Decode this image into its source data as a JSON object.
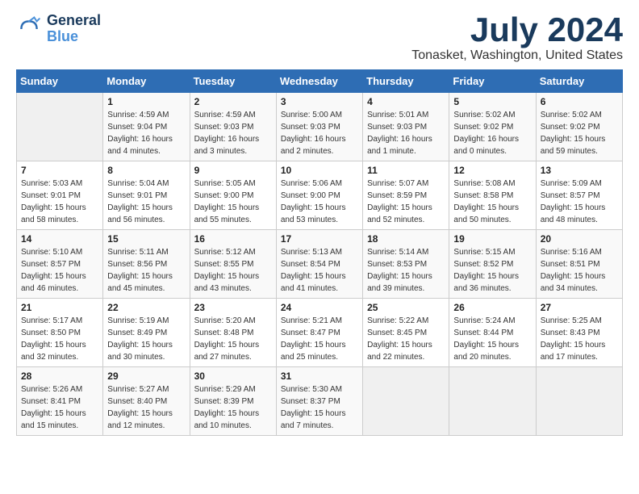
{
  "header": {
    "logo_line1": "General",
    "logo_line2": "Blue",
    "month": "July 2024",
    "location": "Tonasket, Washington, United States"
  },
  "weekdays": [
    "Sunday",
    "Monday",
    "Tuesday",
    "Wednesday",
    "Thursday",
    "Friday",
    "Saturday"
  ],
  "weeks": [
    [
      {
        "day": "",
        "info": ""
      },
      {
        "day": "1",
        "info": "Sunrise: 4:59 AM\nSunset: 9:04 PM\nDaylight: 16 hours\nand 4 minutes."
      },
      {
        "day": "2",
        "info": "Sunrise: 4:59 AM\nSunset: 9:03 PM\nDaylight: 16 hours\nand 3 minutes."
      },
      {
        "day": "3",
        "info": "Sunrise: 5:00 AM\nSunset: 9:03 PM\nDaylight: 16 hours\nand 2 minutes."
      },
      {
        "day": "4",
        "info": "Sunrise: 5:01 AM\nSunset: 9:03 PM\nDaylight: 16 hours\nand 1 minute."
      },
      {
        "day": "5",
        "info": "Sunrise: 5:02 AM\nSunset: 9:02 PM\nDaylight: 16 hours\nand 0 minutes."
      },
      {
        "day": "6",
        "info": "Sunrise: 5:02 AM\nSunset: 9:02 PM\nDaylight: 15 hours\nand 59 minutes."
      }
    ],
    [
      {
        "day": "7",
        "info": "Sunrise: 5:03 AM\nSunset: 9:01 PM\nDaylight: 15 hours\nand 58 minutes."
      },
      {
        "day": "8",
        "info": "Sunrise: 5:04 AM\nSunset: 9:01 PM\nDaylight: 15 hours\nand 56 minutes."
      },
      {
        "day": "9",
        "info": "Sunrise: 5:05 AM\nSunset: 9:00 PM\nDaylight: 15 hours\nand 55 minutes."
      },
      {
        "day": "10",
        "info": "Sunrise: 5:06 AM\nSunset: 9:00 PM\nDaylight: 15 hours\nand 53 minutes."
      },
      {
        "day": "11",
        "info": "Sunrise: 5:07 AM\nSunset: 8:59 PM\nDaylight: 15 hours\nand 52 minutes."
      },
      {
        "day": "12",
        "info": "Sunrise: 5:08 AM\nSunset: 8:58 PM\nDaylight: 15 hours\nand 50 minutes."
      },
      {
        "day": "13",
        "info": "Sunrise: 5:09 AM\nSunset: 8:57 PM\nDaylight: 15 hours\nand 48 minutes."
      }
    ],
    [
      {
        "day": "14",
        "info": "Sunrise: 5:10 AM\nSunset: 8:57 PM\nDaylight: 15 hours\nand 46 minutes."
      },
      {
        "day": "15",
        "info": "Sunrise: 5:11 AM\nSunset: 8:56 PM\nDaylight: 15 hours\nand 45 minutes."
      },
      {
        "day": "16",
        "info": "Sunrise: 5:12 AM\nSunset: 8:55 PM\nDaylight: 15 hours\nand 43 minutes."
      },
      {
        "day": "17",
        "info": "Sunrise: 5:13 AM\nSunset: 8:54 PM\nDaylight: 15 hours\nand 41 minutes."
      },
      {
        "day": "18",
        "info": "Sunrise: 5:14 AM\nSunset: 8:53 PM\nDaylight: 15 hours\nand 39 minutes."
      },
      {
        "day": "19",
        "info": "Sunrise: 5:15 AM\nSunset: 8:52 PM\nDaylight: 15 hours\nand 36 minutes."
      },
      {
        "day": "20",
        "info": "Sunrise: 5:16 AM\nSunset: 8:51 PM\nDaylight: 15 hours\nand 34 minutes."
      }
    ],
    [
      {
        "day": "21",
        "info": "Sunrise: 5:17 AM\nSunset: 8:50 PM\nDaylight: 15 hours\nand 32 minutes."
      },
      {
        "day": "22",
        "info": "Sunrise: 5:19 AM\nSunset: 8:49 PM\nDaylight: 15 hours\nand 30 minutes."
      },
      {
        "day": "23",
        "info": "Sunrise: 5:20 AM\nSunset: 8:48 PM\nDaylight: 15 hours\nand 27 minutes."
      },
      {
        "day": "24",
        "info": "Sunrise: 5:21 AM\nSunset: 8:47 PM\nDaylight: 15 hours\nand 25 minutes."
      },
      {
        "day": "25",
        "info": "Sunrise: 5:22 AM\nSunset: 8:45 PM\nDaylight: 15 hours\nand 22 minutes."
      },
      {
        "day": "26",
        "info": "Sunrise: 5:24 AM\nSunset: 8:44 PM\nDaylight: 15 hours\nand 20 minutes."
      },
      {
        "day": "27",
        "info": "Sunrise: 5:25 AM\nSunset: 8:43 PM\nDaylight: 15 hours\nand 17 minutes."
      }
    ],
    [
      {
        "day": "28",
        "info": "Sunrise: 5:26 AM\nSunset: 8:41 PM\nDaylight: 15 hours\nand 15 minutes."
      },
      {
        "day": "29",
        "info": "Sunrise: 5:27 AM\nSunset: 8:40 PM\nDaylight: 15 hours\nand 12 minutes."
      },
      {
        "day": "30",
        "info": "Sunrise: 5:29 AM\nSunset: 8:39 PM\nDaylight: 15 hours\nand 10 minutes."
      },
      {
        "day": "31",
        "info": "Sunrise: 5:30 AM\nSunset: 8:37 PM\nDaylight: 15 hours\nand 7 minutes."
      },
      {
        "day": "",
        "info": ""
      },
      {
        "day": "",
        "info": ""
      },
      {
        "day": "",
        "info": ""
      }
    ]
  ]
}
